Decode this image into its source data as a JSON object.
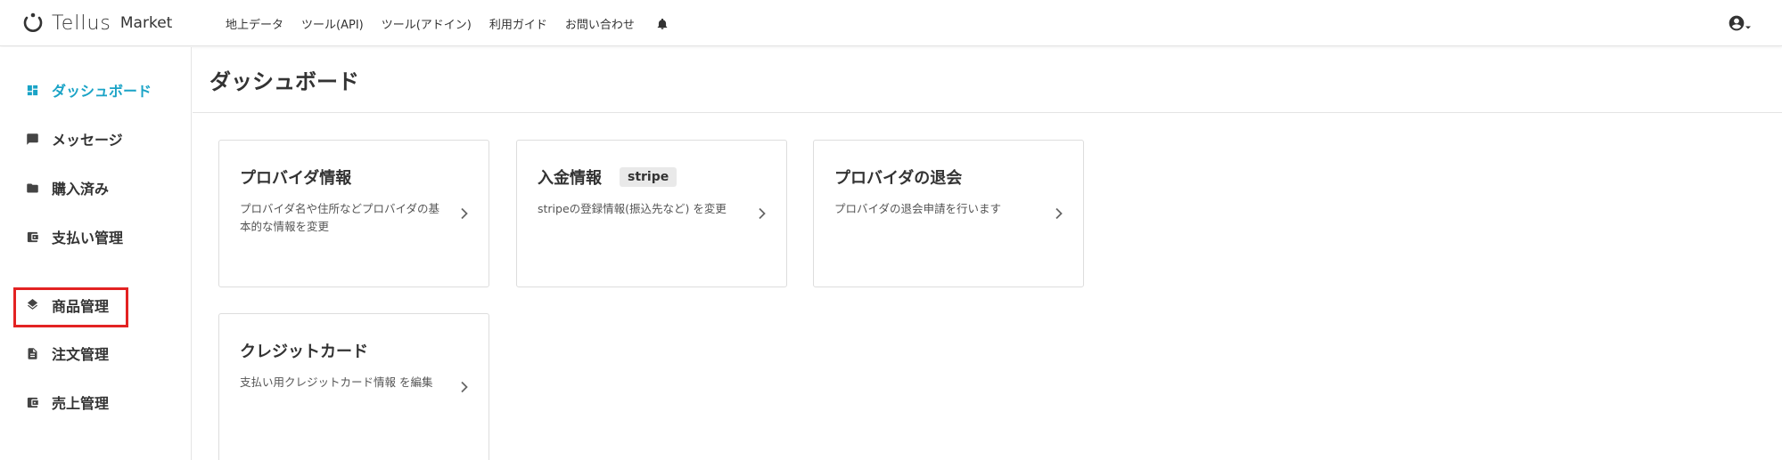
{
  "app": {
    "logo_text": "Tellus",
    "logo_sub": "Market"
  },
  "nav": {
    "items": [
      {
        "label": "地上データ"
      },
      {
        "label": "ツール(API)"
      },
      {
        "label": "ツール(アドイン)"
      },
      {
        "label": "利用ガイド"
      },
      {
        "label": "お問い合わせ"
      }
    ],
    "bell_icon": "bell-icon",
    "user_icon": "account-circle-icon"
  },
  "sidebar": {
    "items": [
      {
        "label": "ダッシュボード",
        "icon": "dashboard-icon",
        "active": true
      },
      {
        "label": "メッセージ",
        "icon": "message-icon"
      },
      {
        "label": "購入済み",
        "icon": "folder-icon"
      },
      {
        "label": "支払い管理",
        "icon": "wallet-icon"
      },
      {
        "label": "商品管理",
        "icon": "layers-icon"
      },
      {
        "label": "注文管理",
        "icon": "document-icon"
      },
      {
        "label": "売上管理",
        "icon": "wallet-icon"
      }
    ],
    "active_color": "#1aa3c6",
    "highlight_color": "#e32222"
  },
  "main": {
    "title": "ダッシュボード",
    "cards": [
      {
        "title": "プロバイダ情報",
        "tag": "",
        "desc": "プロバイダ名や住所などプロバイダの基本的な情報を変更"
      },
      {
        "title": "入金情報",
        "tag": "stripe",
        "desc": "stripeの登録情報(振込先など) を変更"
      },
      {
        "title": "プロバイダの退会",
        "tag": "",
        "desc": "プロバイダの退会申請を行います"
      },
      {
        "title": "クレジットカード",
        "tag": "",
        "desc": "支払い用クレジットカード情報 を編集"
      }
    ]
  }
}
